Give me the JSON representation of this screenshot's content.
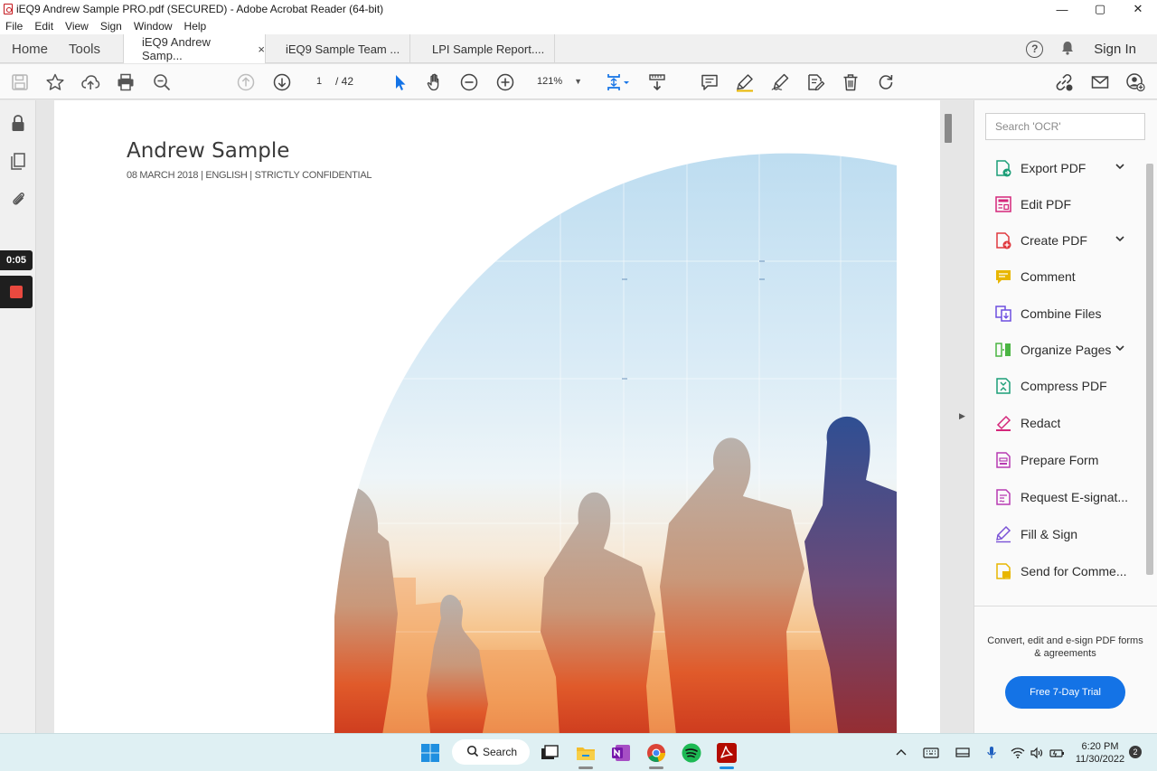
{
  "window": {
    "title": "iEQ9 Andrew Sample PRO.pdf (SECURED) - Adobe Acrobat Reader (64-bit)",
    "minimize": "—",
    "maximize": "▢",
    "close": "✕"
  },
  "menu": [
    "File",
    "Edit",
    "View",
    "Sign",
    "Window",
    "Help"
  ],
  "nav": {
    "home": "Home",
    "tools": "Tools"
  },
  "tabs": [
    {
      "label": "iEQ9 Andrew Samp...",
      "active": true,
      "close": "×"
    },
    {
      "label": "iEQ9 Sample Team ..."
    },
    {
      "label": "LPI Sample Report...."
    }
  ],
  "header_right": {
    "help": "?",
    "signin": "Sign In"
  },
  "toolbar": {
    "page_current": "1",
    "page_total": "/  42",
    "zoom": "121%"
  },
  "recorder": {
    "timer": "0:05"
  },
  "document": {
    "title": "Andrew Sample",
    "subtitle": "08 MARCH 2018 | ENGLISH | STRICTLY CONFIDENTIAL"
  },
  "right_pane": {
    "search_placeholder": "Search 'OCR'",
    "tools": [
      {
        "label": "Export PDF",
        "icon": "export-pdf-icon",
        "color": "#1b9e77",
        "expandable": true
      },
      {
        "label": "Edit PDF",
        "icon": "edit-pdf-icon",
        "color": "#d4267a",
        "expandable": false
      },
      {
        "label": "Create PDF",
        "icon": "create-pdf-icon",
        "color": "#e0393e",
        "expandable": true
      },
      {
        "label": "Comment",
        "icon": "comment-icon",
        "color": "#e8b600",
        "expandable": false
      },
      {
        "label": "Combine Files",
        "icon": "combine-files-icon",
        "color": "#6c4ee0",
        "expandable": false
      },
      {
        "label": "Organize Pages",
        "icon": "organize-pages-icon",
        "color": "#4bb543",
        "expandable": true
      },
      {
        "label": "Compress PDF",
        "icon": "compress-pdf-icon",
        "color": "#1b9e77",
        "expandable": false
      },
      {
        "label": "Redact",
        "icon": "redact-icon",
        "color": "#d4267a",
        "expandable": false
      },
      {
        "label": "Prepare Form",
        "icon": "prepare-form-icon",
        "color": "#b83bb2",
        "expandable": false
      },
      {
        "label": "Request E-signat...",
        "icon": "request-esign-icon",
        "color": "#b83bb2",
        "expandable": false
      },
      {
        "label": "Fill & Sign",
        "icon": "fill-sign-icon",
        "color": "#7a52d6",
        "expandable": false
      },
      {
        "label": "Send for Comme...",
        "icon": "send-for-comment-icon",
        "color": "#e8b600",
        "expandable": false
      }
    ],
    "promo_text": "Convert, edit and e-sign PDF forms & agreements",
    "trial_button": "Free 7-Day Trial"
  },
  "taskbar": {
    "search_label": "Search",
    "time": "6:20 PM",
    "date": "11/30/2022",
    "notifications": "2"
  },
  "colors": {
    "accent_blue": "#1473e6",
    "acrobat_red": "#c4161c",
    "taskbar_bg": "#dff0f3"
  }
}
